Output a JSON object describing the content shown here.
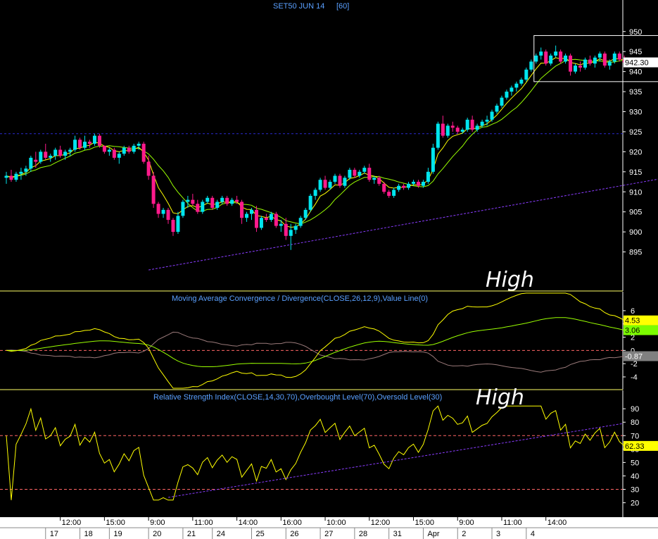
{
  "chart_data": [
    {
      "type": "candlestick",
      "title": "SET50 JUN 14",
      "interval": "[60]",
      "y_ticks": [
        895,
        900,
        905,
        910,
        915,
        920,
        925,
        930,
        935,
        940,
        945,
        950
      ],
      "ylim": [
        890,
        954
      ],
      "last_value_label": "942.30",
      "last_value": 942.3,
      "horizontal_line": 924.5,
      "trendline": {
        "from": [
          29,
          890.5
        ],
        "to": [
          139,
          914.5
        ]
      },
      "highlight_box": {
        "x_from": 108,
        "x_to": 134,
        "y_from": 937.5,
        "y_to": 949
      },
      "annotation": "High",
      "candles": [
        [
          913.5,
          915,
          912,
          914
        ],
        [
          914,
          915.5,
          912.5,
          913
        ],
        [
          913,
          915,
          912.5,
          914.5
        ],
        [
          914.5,
          916,
          913,
          915
        ],
        [
          915,
          916.5,
          914,
          915.8
        ],
        [
          915.8,
          919,
          915,
          918.5
        ],
        [
          918,
          920,
          916,
          917.5
        ],
        [
          917.5,
          920.5,
          917,
          920
        ],
        [
          920,
          922,
          918,
          918.5
        ],
        [
          918.5,
          919.5,
          917.5,
          919
        ],
        [
          919,
          921,
          918,
          920.5
        ],
        [
          920.5,
          921.5,
          918.5,
          919
        ],
        [
          919,
          920.5,
          918,
          920
        ],
        [
          920,
          921,
          919,
          920.5
        ],
        [
          920.5,
          924,
          920,
          923
        ],
        [
          923,
          923.5,
          920.5,
          921
        ],
        [
          921,
          924,
          920.5,
          922.5
        ],
        [
          922.5,
          923,
          921,
          922
        ],
        [
          922,
          924.5,
          921.5,
          924
        ],
        [
          924,
          924.5,
          921,
          921.5
        ],
        [
          921.5,
          921.5,
          919.5,
          920
        ],
        [
          920,
          921,
          919,
          920.5
        ],
        [
          920.5,
          921,
          918,
          918.5
        ],
        [
          918.5,
          920,
          917,
          919.5
        ],
        [
          919.5,
          921.5,
          919,
          921
        ],
        [
          921,
          921.5,
          919.5,
          920
        ],
        [
          920,
          922,
          919.5,
          921.5
        ],
        [
          921.5,
          922.5,
          920.5,
          922
        ],
        [
          922,
          922.5,
          917,
          917.5
        ],
        [
          917.5,
          919,
          913,
          914
        ],
        [
          914,
          915,
          906,
          907
        ],
        [
          907,
          907.5,
          903.5,
          904.5
        ],
        [
          904.5,
          906,
          903.5,
          905.5
        ],
        [
          905.5,
          906,
          902,
          903
        ],
        [
          903,
          903.5,
          899,
          900
        ],
        [
          900,
          905,
          899.5,
          904
        ],
        [
          904,
          908,
          903.5,
          907.5
        ],
        [
          907.5,
          909,
          906,
          908
        ],
        [
          908,
          909.5,
          906.5,
          907
        ],
        [
          907,
          908,
          904.5,
          905
        ],
        [
          905,
          908,
          904.5,
          907.5
        ],
        [
          907.5,
          909,
          907,
          908.5
        ],
        [
          908.5,
          909,
          905.5,
          906
        ],
        [
          906,
          908,
          905.5,
          907.5
        ],
        [
          907.5,
          909,
          907,
          908.5
        ],
        [
          908.5,
          909,
          906.5,
          907
        ],
        [
          907,
          908.5,
          906.5,
          908
        ],
        [
          908,
          909,
          907,
          907.5
        ],
        [
          907.5,
          908,
          902,
          903.5
        ],
        [
          903.5,
          905,
          902.5,
          904.5
        ],
        [
          904.5,
          906,
          903,
          905.5
        ],
        [
          905.5,
          906.5,
          900,
          901
        ],
        [
          901,
          904,
          900.5,
          903.5
        ],
        [
          903.5,
          904.5,
          902.5,
          903
        ],
        [
          903,
          905,
          902.5,
          904.5
        ],
        [
          904.5,
          905,
          901,
          901.5
        ],
        [
          901.5,
          903,
          900,
          902
        ],
        [
          902,
          903.5,
          898,
          899
        ],
        [
          899,
          902,
          895.5,
          900.5
        ],
        [
          900.5,
          902,
          899.5,
          901.5
        ],
        [
          901.5,
          904,
          901,
          903.5
        ],
        [
          903.5,
          906,
          903,
          905.5
        ],
        [
          905.5,
          909.5,
          905,
          909
        ],
        [
          909,
          911,
          908,
          910.5
        ],
        [
          910.5,
          913.5,
          910,
          913
        ],
        [
          913,
          914,
          910.5,
          911
        ],
        [
          911,
          913,
          910.5,
          912.5
        ],
        [
          912.5,
          914.5,
          912,
          914
        ],
        [
          914,
          914.5,
          911,
          911.5
        ],
        [
          911.5,
          914,
          911,
          913.5
        ],
        [
          913.5,
          916,
          913,
          915.5
        ],
        [
          915.5,
          916,
          913.5,
          914
        ],
        [
          914,
          915.5,
          913.5,
          915
        ],
        [
          915,
          916.5,
          914.5,
          916
        ],
        [
          916,
          917,
          912.5,
          913
        ],
        [
          913,
          914,
          912,
          913.5
        ],
        [
          913.5,
          914,
          911.5,
          912
        ],
        [
          912,
          912.5,
          909.5,
          910
        ],
        [
          910,
          910.5,
          908.5,
          909
        ],
        [
          909,
          911,
          908.5,
          910.5
        ],
        [
          910.5,
          912,
          910,
          911.5
        ],
        [
          911.5,
          912,
          910.5,
          911
        ],
        [
          911,
          912.5,
          910.5,
          912
        ],
        [
          912,
          913,
          911.5,
          912.5
        ],
        [
          912.5,
          913,
          911,
          911.5
        ],
        [
          911.5,
          913,
          911,
          912.5
        ],
        [
          912.5,
          916,
          912,
          915
        ],
        [
          915,
          922,
          914.5,
          921
        ],
        [
          921,
          927.5,
          920.5,
          927
        ],
        [
          927,
          929,
          923.5,
          924
        ],
        [
          924,
          927,
          923.5,
          926.5
        ],
        [
          926.5,
          927.5,
          925,
          926
        ],
        [
          926,
          926.5,
          924.5,
          925
        ],
        [
          925,
          926,
          924.5,
          925.5
        ],
        [
          925.5,
          928.5,
          925,
          928
        ],
        [
          928,
          929,
          925,
          925.5
        ],
        [
          925.5,
          927,
          925,
          926.5
        ],
        [
          926.5,
          928,
          926,
          927.5
        ],
        [
          927.5,
          929,
          926.5,
          928
        ],
        [
          928,
          930.5,
          927.5,
          930
        ],
        [
          930,
          932,
          929.5,
          931.5
        ],
        [
          931.5,
          934,
          931,
          933.5
        ],
        [
          933.5,
          935.5,
          933,
          935
        ],
        [
          935,
          936.5,
          934,
          936
        ],
        [
          936,
          937.5,
          935,
          937
        ],
        [
          937,
          938.5,
          936.5,
          938
        ],
        [
          938,
          941,
          937.5,
          940.5
        ],
        [
          940.5,
          943,
          940,
          942.5
        ],
        [
          942.5,
          944.5,
          942,
          944
        ],
        [
          944,
          946,
          943,
          945
        ],
        [
          945,
          945.5,
          941.5,
          942
        ],
        [
          942,
          944.5,
          941.5,
          944
        ],
        [
          944,
          946.5,
          943.5,
          945
        ],
        [
          945,
          945.5,
          942,
          942.5
        ],
        [
          942.5,
          944.5,
          942,
          944
        ],
        [
          944,
          944.5,
          939,
          940
        ],
        [
          940,
          942,
          939.5,
          941.5
        ],
        [
          941.5,
          942.5,
          940,
          941
        ],
        [
          941,
          943.5,
          940.5,
          943
        ],
        [
          943,
          944,
          941.5,
          942
        ],
        [
          942,
          944,
          941,
          943.5
        ],
        [
          943.5,
          945,
          942.5,
          944.5
        ],
        [
          944.5,
          945,
          941,
          941.5
        ],
        [
          941.5,
          943,
          940.5,
          942.5
        ],
        [
          942.5,
          945,
          942,
          944.5
        ],
        [
          944.5,
          945,
          942.5,
          943
        ],
        [
          943,
          944,
          942,
          942.3
        ]
      ],
      "moving_averages": [
        "yellow",
        "lime"
      ]
    },
    {
      "type": "line",
      "title": "Moving Average Convergence / Divergence(CLOSE,26,12,9),Value Line(0)",
      "y_ticks": [
        -4,
        -2,
        0,
        2,
        4,
        6
      ],
      "ylim": [
        -5.6,
        7.8
      ],
      "annotation": "High",
      "zero_line": 0,
      "badges": [
        {
          "text": "4.53",
          "value": 4.53,
          "color": "#ffff00"
        },
        {
          "text": "3.06",
          "value": 3.06,
          "color": "#7cfc00"
        },
        {
          "text": "-0.87",
          "value": -0.87,
          "color": "#808080"
        }
      ]
    },
    {
      "type": "line",
      "title": "Relative Strength Index(CLOSE,14,30,70),Overbought Level(70),Oversold Level(30)",
      "y_ticks": [
        20,
        30,
        40,
        50,
        60,
        70,
        80,
        90
      ],
      "ylim": [
        14,
        99
      ],
      "overbought": 70,
      "oversold": 30,
      "annotation": "High",
      "last_value_label": "62.33",
      "last_value": 62.33
    }
  ],
  "x_axis": {
    "time_labels": [
      {
        "label": "12:00",
        "i": 11
      },
      {
        "label": "15:00",
        "i": 20
      },
      {
        "label": "9:00",
        "i": 29
      },
      {
        "label": "11:00",
        "i": 38
      },
      {
        "label": "14:00",
        "i": 47
      },
      {
        "label": "16:00",
        "i": 56
      },
      {
        "label": "10:00",
        "i": 65
      },
      {
        "label": "12:00",
        "i": 74
      },
      {
        "label": "15:00",
        "i": 83
      },
      {
        "label": "9:00",
        "i": 92
      },
      {
        "label": "11:00",
        "i": 101
      },
      {
        "label": "14:00",
        "i": 110
      }
    ],
    "date_labels": [
      {
        "label": "17",
        "i": 8
      },
      {
        "label": "18",
        "i": 15
      },
      {
        "label": "19",
        "i": 21
      },
      {
        "label": "20",
        "i": 29
      },
      {
        "label": "21",
        "i": 36
      },
      {
        "label": "24",
        "i": 42
      },
      {
        "label": "25",
        "i": 50
      },
      {
        "label": "26",
        "i": 57
      },
      {
        "label": "27",
        "i": 64
      },
      {
        "label": "28",
        "i": 71
      },
      {
        "label": "31",
        "i": 78
      },
      {
        "label": "Apr",
        "i": 85
      },
      {
        "label": "2",
        "i": 92
      },
      {
        "label": "3",
        "i": 99
      },
      {
        "label": "4",
        "i": 106
      }
    ]
  },
  "colors": {
    "up": "#00e5ee",
    "down": "#ff1a8c",
    "ma_yellow": "#ffff00",
    "ma_green": "#9aff00",
    "panel_border": "#ffff66",
    "title": "#5aa0ff",
    "grid_dash": "#1f1f8f",
    "ref_line": "#ff6666",
    "trend": "#8a3cff"
  }
}
